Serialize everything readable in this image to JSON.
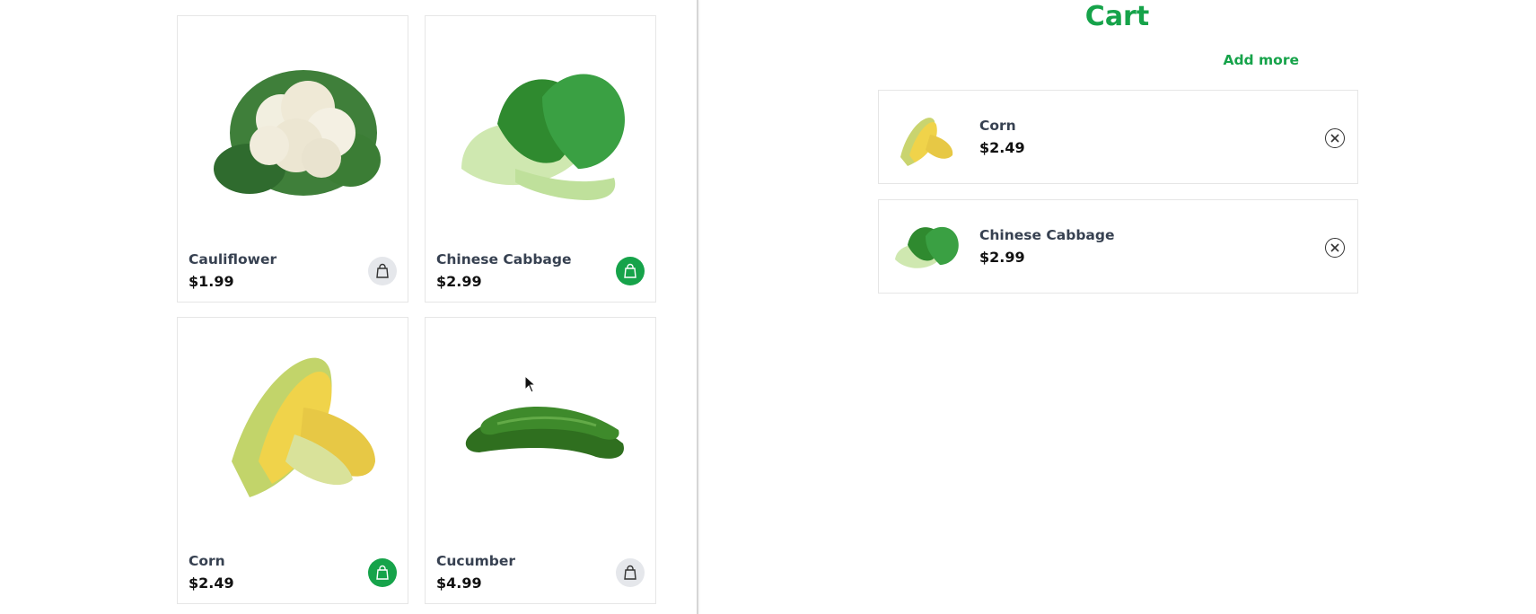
{
  "catalog": {
    "products": [
      {
        "name": "Cauliflower",
        "price": "$1.99",
        "in_cart": false,
        "icon": "shopping-bag-icon"
      },
      {
        "name": "Chinese Cabbage",
        "price": "$2.99",
        "in_cart": true,
        "icon": "shopping-bag-icon"
      },
      {
        "name": "Corn",
        "price": "$2.49",
        "in_cart": true,
        "icon": "shopping-bag-icon"
      },
      {
        "name": "Cucumber",
        "price": "$4.99",
        "in_cart": false,
        "icon": "shopping-bag-icon"
      }
    ]
  },
  "cart": {
    "title": "Cart",
    "add_more_label": "Add more",
    "items": [
      {
        "name": "Corn",
        "price": "$2.49",
        "icon": "close-icon"
      },
      {
        "name": "Chinese Cabbage",
        "price": "$2.99",
        "icon": "close-icon"
      }
    ]
  },
  "colors": {
    "accent": "#16a34a",
    "button_inactive": "#e5e7eb",
    "text_muted": "#374151"
  }
}
